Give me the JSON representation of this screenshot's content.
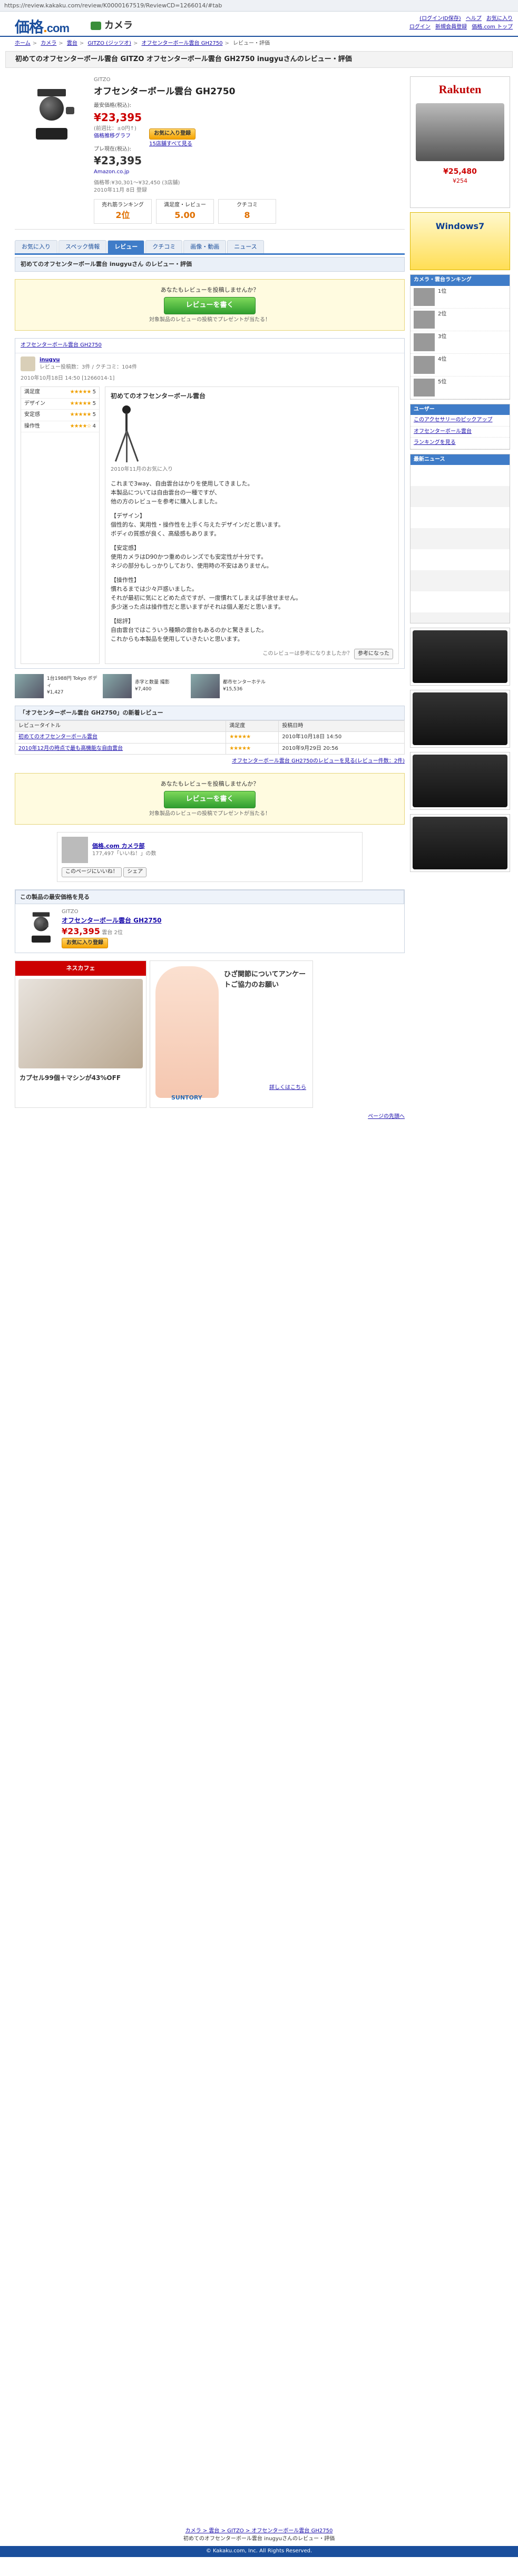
{
  "browser": {
    "url": "https://review.kakaku.com/review/K0000167519/ReviewCD=1266014/#tab"
  },
  "site": {
    "logo_main": "価格",
    "logo_dot": ".",
    "logo_com": "com",
    "category": "カメラ",
    "top_links": [
      "(ログインID保存)",
      "ヘルプ",
      "お気に入り",
      "ログイン",
      "新規会員登録",
      "価格.com トップ"
    ]
  },
  "breadcrumb": [
    "ホーム",
    "カメラ",
    "雲台",
    "GITZO (ジッツオ)",
    "オフセンターボール雲台 GH2750",
    "レビュー・評価"
  ],
  "title": "初めてのオフセンターボール雲台 GITZO オフセンターボール雲台 GH2750 inugyuさんのレビュー・評価",
  "product": {
    "maker": "GITZO",
    "name": "オフセンターボール雲台 GH2750",
    "date": "2010年11月 8日 登録",
    "price_label": "最安価格(税込):",
    "price": "¥23,395",
    "price_note": "(前週比：±0円↑)",
    "price_graph": "価格推移グラフ",
    "price2_label": "プレ現在(税込):",
    "price2": "¥23,395",
    "price2_note": "Amazon.co.jp",
    "cart_btn": "お気に入り登録",
    "shops": "15店舗すべて見る",
    "range": "価格帯:¥30,301～¥32,450 (3店舗)",
    "rank_label": "売れ筋ランキング",
    "rank_val": "2位",
    "satis_label": "満足度・レビュー",
    "satis_val": "5.00",
    "cc_label": "クチコミ",
    "cc_val": "8"
  },
  "tabs": [
    "お気に入り",
    "スペック情報",
    "レビュー",
    "クチコミ",
    "画像・動画",
    "ニュース"
  ],
  "review_header": "初めてのオフセンターボール雲台 inugyuさん のレビュー・評価",
  "post": {
    "q": "あなたもレビューを投稿しませんか？",
    "btn": "レビューを書く",
    "note": "対象製品のレビューの投稿でプレゼントが当たる！"
  },
  "reviewer": {
    "name": "inugyu",
    "meta": "レビュー投稿数：3件 / クチコミ：104件",
    "product_title": "オフセンターボール雲台 GH2750"
  },
  "scores": [
    {
      "k": "満足度",
      "s": "★★★★★",
      "v": "5"
    },
    {
      "k": "デザイン",
      "s": "★★★★★",
      "v": "5"
    },
    {
      "k": "安定感",
      "s": "★★★★★",
      "v": "5"
    },
    {
      "k": "操作性",
      "s": "★★★★☆",
      "v": "4"
    }
  ],
  "review": {
    "date": "2010年10月18日 14:50 [1266014-1]",
    "title": "初めてのオフセンターボール雲台",
    "caption": "2010年11月のお気に入り",
    "paras": [
      "これまで3way、自由雲台はかりを使用してきました。\n本製品については自由雲台の一種ですが、\n他の方のレビューを参考に購入しました。",
      "【デザイン】\n個性的な、実用性・操作性を上手く与えたデザインだと思います。\nボディの質感が良く、高級感もあります。",
      "【安定感】\n使用カメラはD90かつ重めのレンズでも安定性が十分です。\nネジの部分もしっかりしており、使用時の不安はありません。",
      "【操作性】\n慣れるまでは少々戸惑いました。\nそれが最初に気にとどめた点ですが、一度慣れてしまえば手放せません。\n多少迷った点は操作性だと思いますがそれは個人差だと思います。",
      "【総評】\n自由雲台ではこういう種類の雲台もあるのかと驚きました。\nこれからも本製品を使用していきたいと思います。"
    ],
    "helpful": "参考になった",
    "footer_note": "このレビューは参考になりましたか？"
  },
  "thumbs": [
    {
      "t": "1台1988円 Tokyo ボディ",
      "p": "¥1,427"
    },
    {
      "t": "赤字と数量 撮影",
      "p": "¥7,400"
    },
    {
      "t": "都市センターホテル",
      "p": "¥15,536"
    }
  ],
  "related": {
    "head": "「オフセンターボール雲台 GH2750」の新着レビュー",
    "cols": [
      "レビュータイトル",
      "満足度",
      "投稿日時"
    ],
    "rows": [
      {
        "t": "初めてのオフセンターボール雲台",
        "s": "★★★★★",
        "d": "2010年10月18日 14:50"
      },
      {
        "t": "2010年12月の時点で最も高機能な自由雲台",
        "s": "★★★★★",
        "d": "2010年9月29日 20:56"
      }
    ],
    "more": "オフセンターボール雲台 GH2750のレビューを見る(レビュー件数：2件)"
  },
  "fb": {
    "name": "価格.com カメラ部",
    "likes": "177,497「いいね！」の数",
    "comment": "このページにいいね！",
    "share": "シェア"
  },
  "prodbox": {
    "head": "この製品の最安価格を見る",
    "maker": "GITZO",
    "name": "オフセンターボール雲台 GH2750",
    "price": "¥23,395",
    "rank": "雲台 2位",
    "cart": "お気に入り登録"
  },
  "ad": {
    "left_title": "ネスカフェ",
    "left_sub": "カプセル99個＋マシンが43%OFF",
    "right_title": "ひざ関節についてアンケートご協力のお願い",
    "right_sub": "詳しくはこちら",
    "brand": "SUNTORY"
  },
  "pager": "ページの先頭へ",
  "sidebar": {
    "price": "¥25,480",
    "points": "¥254",
    "rk": "Rakuten",
    "win": "Windows7",
    "ranking_head": "カメラ・雲台ランキング",
    "ranking": [
      "1位",
      "2位",
      "3位",
      "4位",
      "5位"
    ],
    "news_head": "最新ニュース",
    "menu_head": "ユーザー",
    "links": [
      "このアクセサリーのピックアップ",
      "オフセンターボール雲台",
      "ランキングを見る"
    ]
  },
  "footer": {
    "crumb": "カメラ > 雲台 > GITZO > オフセンターボール雲台 GH2750",
    "crumb2": "初めてのオフセンターボール雲台 inugyuさんのレビュー・評価",
    "copy": "© Kakaku.com, Inc. All Rights Reserved."
  }
}
